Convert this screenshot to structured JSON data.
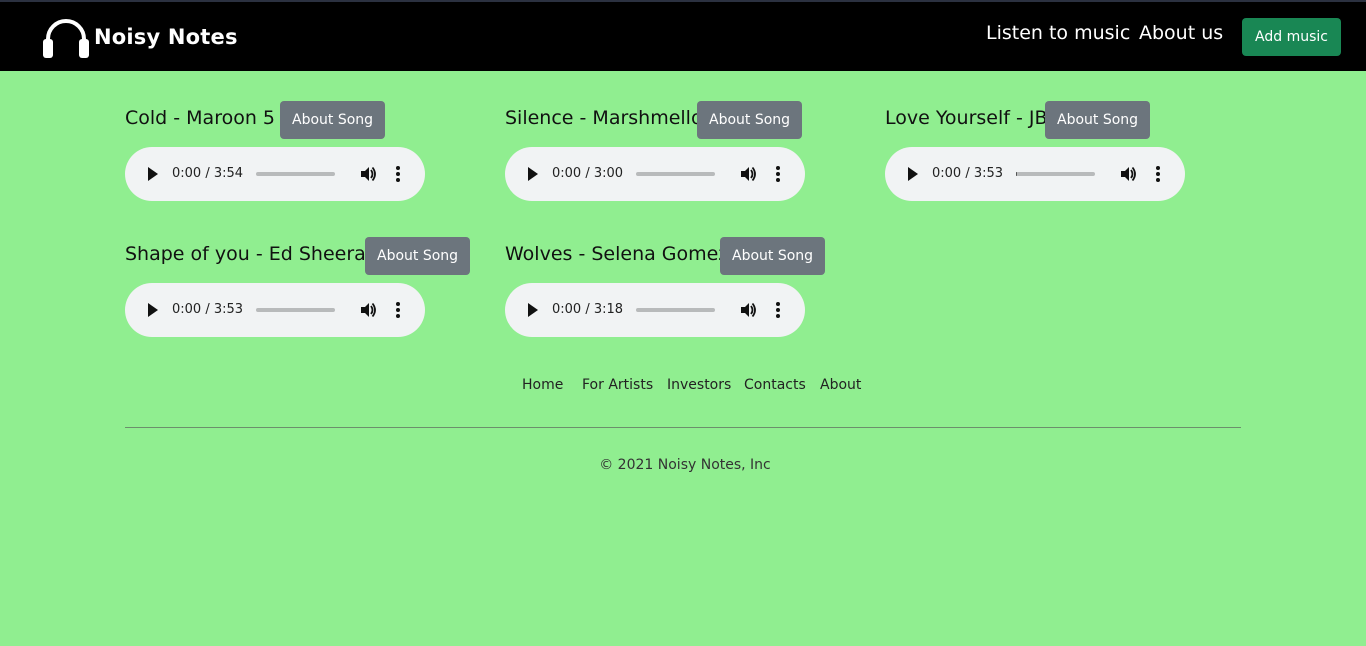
{
  "navbar": {
    "brand": "Noisy Notes",
    "links": [
      "Listen to music",
      "About us"
    ],
    "add_button": "Add music"
  },
  "songs": [
    {
      "title": "Cold - Maroon 5",
      "button": "About Song",
      "time": "0:00 / 3:54",
      "progress": 0
    },
    {
      "title": "Silence - Marshmello",
      "button": "About Song",
      "time": "0:00 / 3:00",
      "progress": 0
    },
    {
      "title": "Love Yourself - JB",
      "button": "About Song",
      "time": "0:00 / 3:53",
      "progress": 0.01
    },
    {
      "title": "Shape of you - Ed Sheeran",
      "button": "About Song",
      "time": "0:00 / 3:53",
      "progress": 0
    },
    {
      "title": "Wolves - Selena Gomez",
      "button": "About Song",
      "time": "0:00 / 3:18",
      "progress": 0
    }
  ],
  "footer": {
    "links": [
      "Home",
      "For Artists",
      "Investors",
      "Contacts",
      "About"
    ],
    "copyright": "© 2021 Noisy Notes, Inc"
  },
  "icons": {
    "brand": "headphones-icon",
    "play": "play-icon",
    "volume": "volume-icon",
    "more": "more-vertical-icon"
  },
  "colors": {
    "background": "#90ee90",
    "navbar": "#000000",
    "add_button": "#198754",
    "about_button": "#6c757d",
    "player": "#f1f3f4"
  }
}
